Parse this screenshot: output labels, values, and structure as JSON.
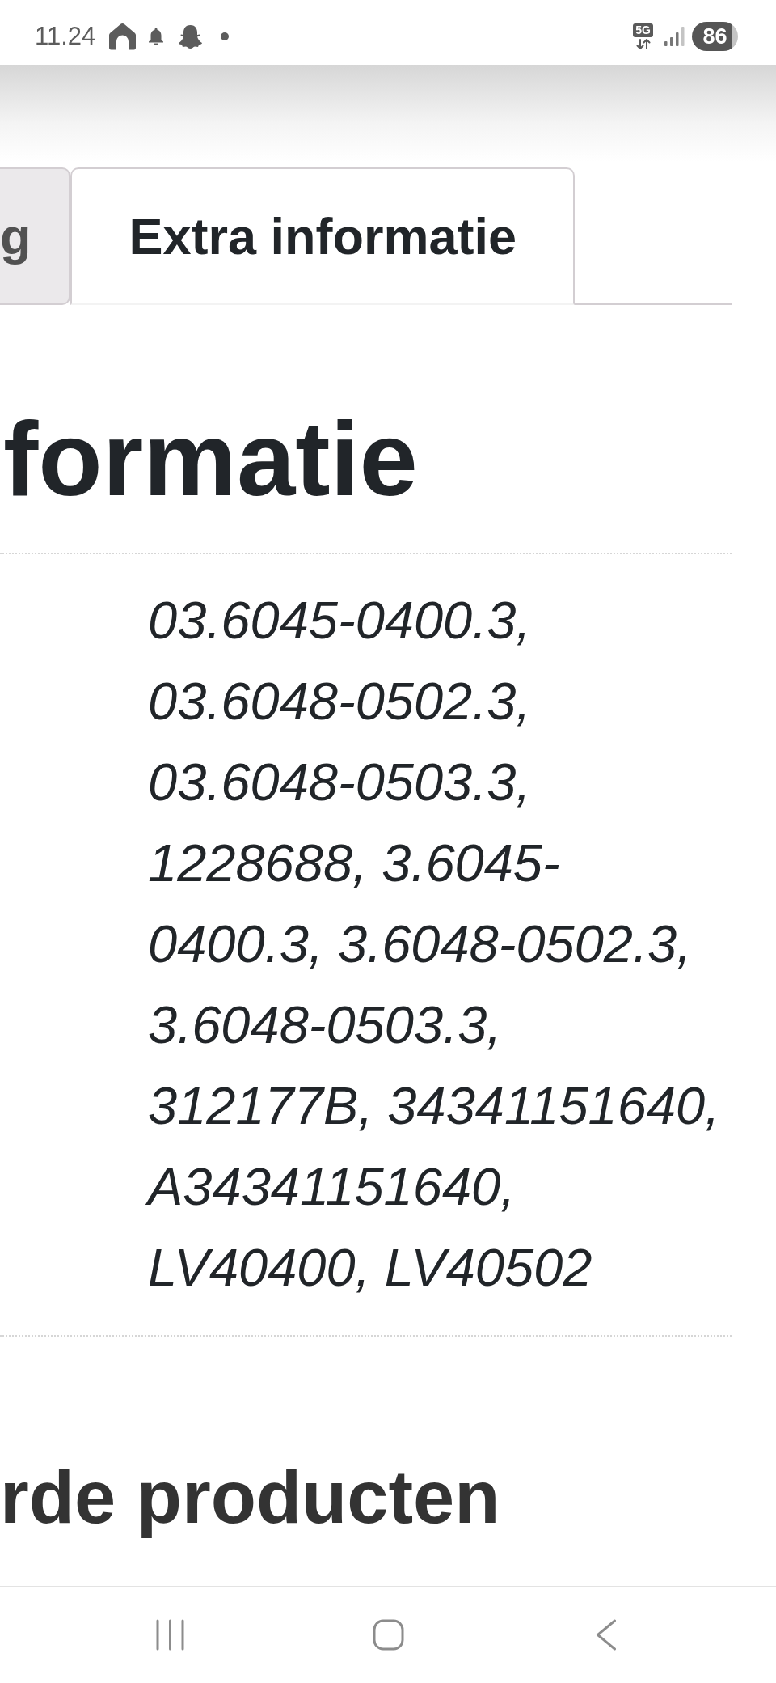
{
  "status_bar": {
    "time": "11.24",
    "network": "5G",
    "battery": "86"
  },
  "tabs": [
    {
      "label": "g",
      "selected": false
    },
    {
      "label": "Extra informatie",
      "selected": true
    }
  ],
  "heading": "formatie",
  "attributes_table": {
    "rows": [
      {
        "value": "03.6045-0400.3, 03.6048-0502.3, 03.6048-0503.3, 1228688, 3.6045-0400.3, 3.6048-0502.3, 3.6048-0503.3, 312177B, 34341151640, A34341151640, LV40400, LV40502"
      }
    ]
  },
  "related_heading": "rde producten"
}
